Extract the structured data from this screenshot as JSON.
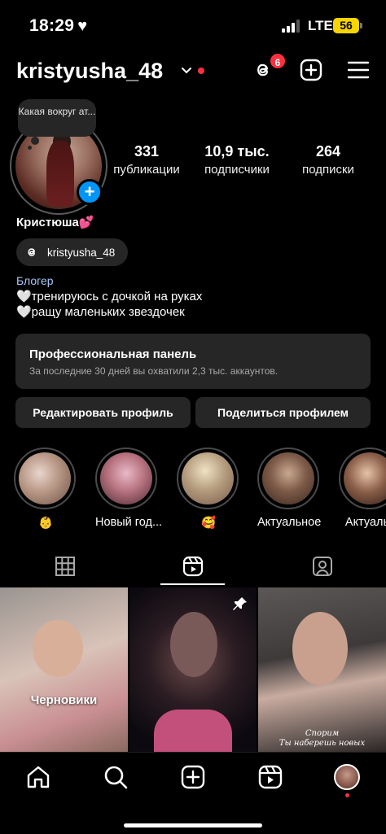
{
  "status_bar": {
    "time": "18:29",
    "network": "LTE",
    "battery": "56"
  },
  "header": {
    "username": "kristyusha_48",
    "threads_badge": "6"
  },
  "profile": {
    "note": "Какая вокруг ат...",
    "stats": [
      {
        "value": "331",
        "label": "публикации"
      },
      {
        "value": "10,9 тыс.",
        "label": "подписчики"
      },
      {
        "value": "264",
        "label": "подписки"
      }
    ],
    "name": "Кристюша💕",
    "threads_handle": "kristyusha_48",
    "category": "Блогер",
    "bio_lines": [
      "🤍тренируюсь с дочкой на руках",
      "🤍ращу маленьких звездочек"
    ]
  },
  "pro_panel": {
    "title": "Профессиональная панель",
    "subtitle": "За последние 30 дней вы охватили 2,3 тыс. аккаунтов."
  },
  "buttons": {
    "edit": "Редактировать профиль",
    "share": "Поделиться профилем"
  },
  "highlights": [
    {
      "label": "👶"
    },
    {
      "label": "Новый год..."
    },
    {
      "label": "🥰"
    },
    {
      "label": "Актуальное"
    },
    {
      "label": "Актуальн"
    }
  ],
  "grid": {
    "drafts_label": "Черновики",
    "overlay_text_line1": "Спорим",
    "overlay_text_line2": "Ты наберешь новых"
  },
  "colors": {
    "accent": "#0095f6",
    "notification": "#ff3040",
    "surface": "#262626",
    "category": "#a8c7fa",
    "battery": "#f6d500"
  }
}
